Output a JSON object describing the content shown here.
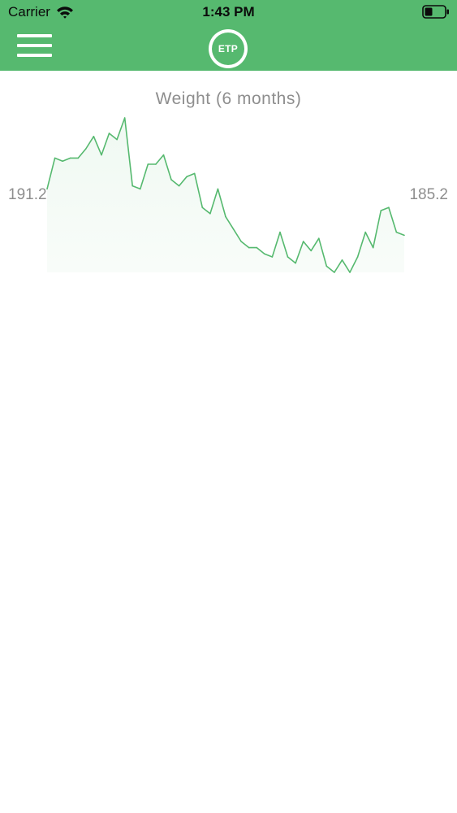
{
  "status_bar": {
    "carrier": "Carrier",
    "time": "1:43 PM"
  },
  "nav": {
    "logo_text": "ETP"
  },
  "colors": {
    "brand_green": "#56b96f",
    "line_green": "#56b96f",
    "text_gray": "#8e8e8e"
  },
  "icons": [
    "wifi-icon",
    "battery-icon",
    "hamburger-menu-icon",
    "etp-logo"
  ],
  "chart_data": {
    "type": "area",
    "title": "Weight (6 months)",
    "start_value_label": "191.2",
    "end_value_label": "185.2",
    "grid": false,
    "legend": "none",
    "series": [
      {
        "values": [
          191.5,
          192.5,
          192.4,
          192.5,
          192.5,
          192.8,
          193.2,
          192.6,
          193.3,
          193.1,
          193.8,
          191.6,
          191.5,
          192.3,
          192.3,
          192.6,
          191.8,
          191.6,
          191.9,
          192.0,
          190.9,
          190.7,
          191.5,
          190.6,
          190.2,
          189.8,
          189.6,
          189.6,
          189.4,
          189.3,
          190.1,
          189.3,
          189.1,
          189.8,
          189.5,
          189.9,
          189.0,
          188.8,
          189.2,
          188.8,
          189.3,
          190.1,
          189.6,
          190.8,
          190.9,
          190.1,
          190.0
        ]
      }
    ]
  }
}
